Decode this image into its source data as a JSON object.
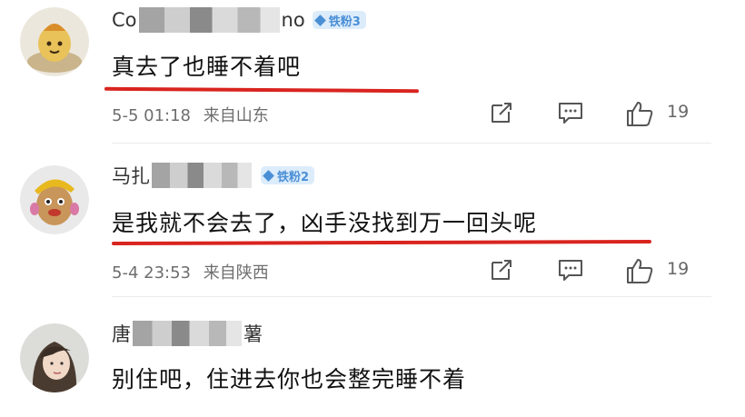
{
  "comments": [
    {
      "name_start": "Co",
      "name_end": "no",
      "badge": "铁粉3",
      "text": "真去了也睡不着吧",
      "date": "5-5 01:18",
      "location": "来自山东",
      "likes": "19",
      "avatar_icon": "potato-mascot-avatar"
    },
    {
      "name_start": "马扎",
      "name_end": "",
      "badge": "铁粉2",
      "text": "是我就不会去了，凶手没找到万一回头呢",
      "date": "5-4 23:53",
      "location": "来自陕西",
      "likes": "19",
      "avatar_icon": "potato-head-avatar"
    },
    {
      "name_start": "唐",
      "name_end": "薯",
      "badge": "",
      "text": "别住吧，住进去你也会整完睡不着",
      "avatar_icon": "girl-photo-avatar"
    }
  ],
  "colors": {
    "underline": "#d9241f",
    "badge_bg": "#dcecfb",
    "badge_fg": "#4a8fd6",
    "meta": "#6e6e6e"
  }
}
